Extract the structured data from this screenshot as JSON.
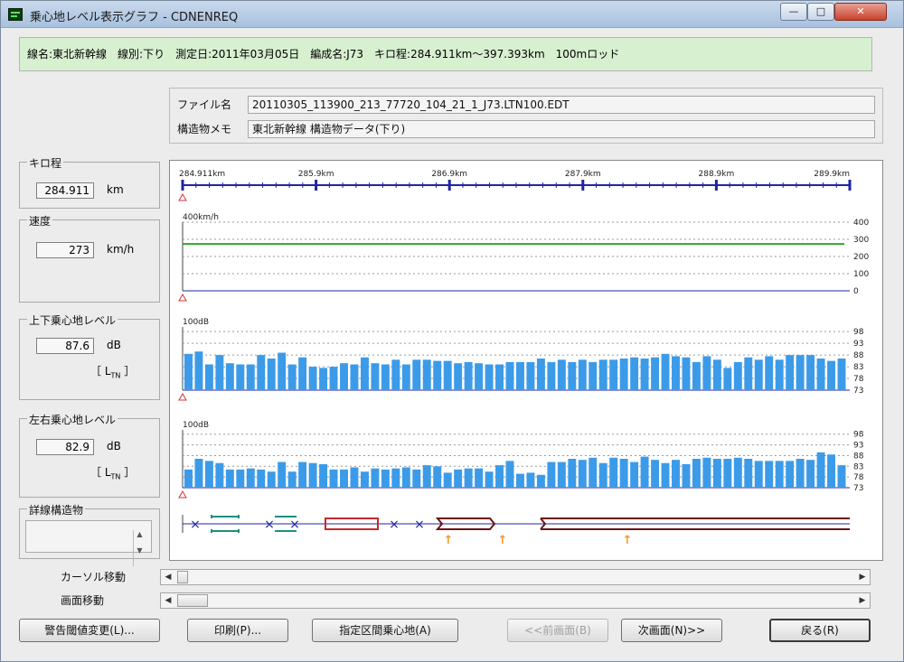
{
  "window": {
    "title": "乗心地レベル表示グラフ - CDNENREQ",
    "minimize_glyph": "—",
    "maximize_glyph": "□",
    "close_glyph": "✕"
  },
  "info_bar": {
    "text": "線名:東北新幹線　線別:下り　測定日:2011年03月05日　編成名:J73　キロ程:284.911km～397.393km　100mロッド"
  },
  "file": {
    "name_label": "ファイル名",
    "name_value": "20110305_113900_213_77720_104_21_1_J73.LTN100.EDT",
    "memo_label": "構造物メモ",
    "memo_value": "東北新幹線 構造物データ(下り)"
  },
  "panels": {
    "kilo": {
      "title": "キロ程",
      "value": "284.911",
      "unit": "km"
    },
    "speed": {
      "title": "速度",
      "value": "273",
      "unit": "km/h"
    },
    "vertical": {
      "title": "上下乗心地レベル",
      "value": "87.6",
      "unit": "dB",
      "ltn_main": "［ L",
      "ltn_sub": "TN",
      "ltn_end": " ］"
    },
    "lateral": {
      "title": "左右乗心地レベル",
      "value": "82.9",
      "unit": "dB",
      "ltn_main": "［ L",
      "ltn_sub": "TN",
      "ltn_end": " ］"
    },
    "structure": {
      "title": "詳線構造物"
    }
  },
  "chart_data": [
    {
      "type": "axis",
      "name": "kilo-axis",
      "tick_labels": [
        "284.911km",
        "285.9km",
        "286.9km",
        "287.9km",
        "288.9km",
        "289.9km"
      ]
    },
    {
      "type": "line",
      "name": "speed",
      "top_label": "400km/h",
      "ylim": [
        0,
        400
      ],
      "y_ticks": [
        0,
        100,
        200,
        300,
        400
      ],
      "values": [
        273
      ]
    },
    {
      "type": "bar",
      "name": "vertical-level",
      "top_label": "100dB",
      "ylim": [
        73,
        100
      ],
      "y_ticks": [
        73,
        78,
        83,
        88,
        93,
        98
      ],
      "values": [
        88.5,
        89.5,
        84,
        88,
        84.5,
        84,
        84,
        88,
        86.5,
        89,
        84,
        87,
        83,
        82.5,
        83,
        84.5,
        84,
        87,
        84.5,
        84,
        86,
        84,
        86,
        86,
        85.5,
        85.5,
        84.5,
        85,
        84.5,
        84,
        84,
        85,
        85,
        85,
        86.5,
        85,
        86,
        85,
        86,
        85,
        86,
        86,
        86.5,
        87,
        86.5,
        87,
        88.5,
        87.5,
        87,
        85,
        87.5,
        86,
        82.5,
        85,
        87,
        86,
        87.5,
        86,
        88,
        88,
        88,
        86.5,
        85.5,
        86.5
      ],
      "color": "#3c9be8"
    },
    {
      "type": "bar",
      "name": "lateral-level",
      "top_label": "100dB",
      "ylim": [
        73,
        100
      ],
      "y_ticks": [
        73,
        78,
        83,
        88,
        93,
        98
      ],
      "values": [
        81.5,
        86.5,
        85.5,
        84.5,
        81.5,
        81.5,
        82,
        81.5,
        80.5,
        85,
        80.5,
        85,
        84.5,
        84,
        81.5,
        81.5,
        82.5,
        80.5,
        82,
        81.5,
        82,
        82.5,
        81.5,
        83.5,
        83,
        80,
        81.5,
        82,
        82,
        80.5,
        83.5,
        85.5,
        79.5,
        80,
        79,
        85,
        85,
        86.5,
        86,
        87,
        84.5,
        87,
        86.5,
        85,
        87.5,
        86,
        84.5,
        86,
        84,
        86.5,
        87,
        86.5,
        86.5,
        87,
        86.5,
        85.5,
        85.5,
        85.5,
        85.5,
        86.5,
        86,
        89.5,
        88.5,
        83.5
      ],
      "color": "#3c9be8"
    }
  ],
  "scroll": {
    "cursor_label": "カーソル移動",
    "screen_label": "画面移動",
    "left_glyph": "◀",
    "right_glyph": "▶"
  },
  "buttons": {
    "threshold": "警告閾値変更(L)...",
    "print": "印刷(P)...",
    "section": "指定区間乗心地(A)",
    "prev": "<<前画面(B)",
    "next": "次画面(N)>>",
    "back": "戻る(R)"
  },
  "colors": {
    "axis_blue": "#1f24a6",
    "speed_green": "#2ea52e",
    "bar_blue": "#3c9be8",
    "marker_red": "#d63030",
    "structure_teal": "#1f8f80",
    "structure_red": "#c42a2a",
    "structure_darkred": "#6b1414",
    "arrow_orange": "#f09a2a"
  }
}
